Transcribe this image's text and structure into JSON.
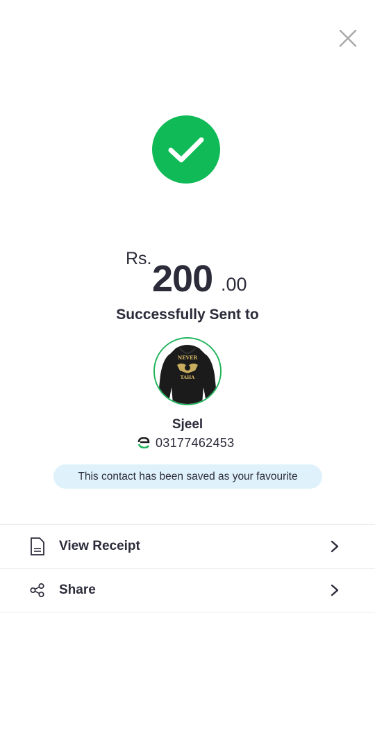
{
  "header": {
    "close_icon": "close-icon"
  },
  "status": {
    "icon": "checkmark-icon",
    "color": "#0fba57"
  },
  "amount": {
    "currency": "Rs.",
    "whole": "200",
    "decimals": ".00"
  },
  "message": "Successfully Sent to",
  "recipient": {
    "avatar_text_top": "NEVER",
    "avatar_text_bottom": "TAHA",
    "name": "Sjeel",
    "provider_icon": "easypaisa-logo-icon",
    "phone": "03177462453"
  },
  "favourite_notice": "This contact has been saved as your favourite",
  "actions": [
    {
      "label": "View Receipt",
      "icon": "receipt-icon"
    },
    {
      "label": "Share",
      "icon": "share-icon"
    }
  ],
  "colors": {
    "success": "#0fba57",
    "pill_bg": "#dff2fb",
    "text": "#2b2b3a"
  }
}
